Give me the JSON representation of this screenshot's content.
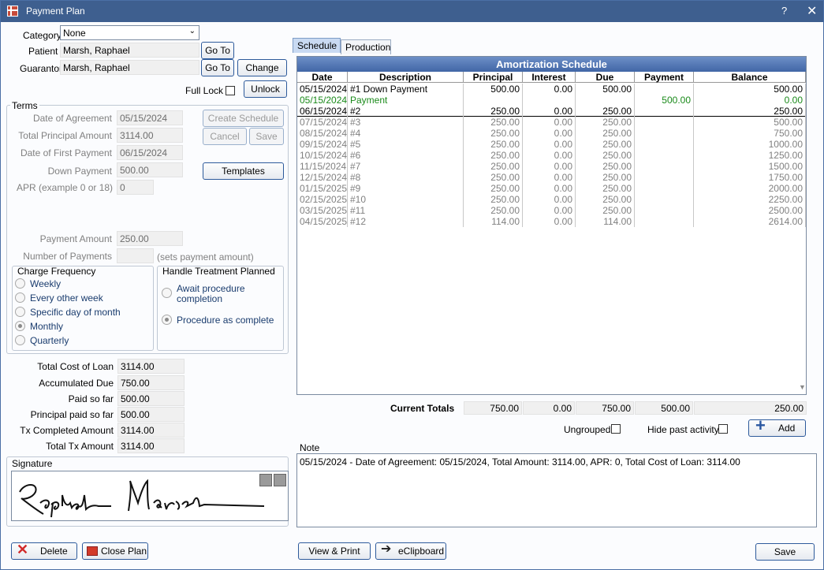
{
  "window": {
    "title": "Payment Plan",
    "help": "?",
    "close": "✕"
  },
  "form": {
    "category_label": "Category",
    "category_value": "None",
    "patient_label": "Patient",
    "patient_value": "Marsh, Raphael",
    "guarantor_label": "Guarantor",
    "guarantor_value": "Marsh, Raphael",
    "goto_label": "Go To",
    "change_label": "Change",
    "full_lock_label": "Full Lock",
    "unlock_label": "Unlock"
  },
  "terms": {
    "title": "Terms",
    "date_of_agreement_label": "Date of Agreement",
    "date_of_agreement": "05/15/2024",
    "total_principal_label": "Total Principal Amount",
    "total_principal": "3114.00",
    "first_payment_label": "Date of First Payment",
    "first_payment": "06/15/2024",
    "down_payment_label": "Down Payment",
    "down_payment": "500.00",
    "apr_label": "APR (example 0 or 18)",
    "apr": "0",
    "payment_amount_label": "Payment Amount",
    "payment_amount": "250.00",
    "num_payments_label": "Number of Payments",
    "num_payments": "",
    "sets_payment_label": "(sets payment amount)",
    "create_schedule": "Create Schedule",
    "cancel": "Cancel",
    "save": "Save",
    "templates": "Templates"
  },
  "charge_frequency": {
    "title": "Charge Frequency",
    "options": [
      "Weekly",
      "Every other week",
      "Specific day of month",
      "Monthly",
      "Quarterly"
    ],
    "selected": "Monthly"
  },
  "treatment": {
    "title": "Handle Treatment Planned",
    "opt1_line1": "Await procedure",
    "opt1_line2": "completion",
    "opt2": "Procedure as complete"
  },
  "summary": {
    "total_cost_label": "Total Cost of Loan",
    "total_cost": "3114.00",
    "accumulated_due_label": "Accumulated Due",
    "accumulated_due": "750.00",
    "paid_so_far_label": "Paid so far",
    "paid_so_far": "500.00",
    "principal_paid_label": "Principal paid so far",
    "principal_paid": "500.00",
    "tx_completed_label": "Tx Completed Amount",
    "tx_completed": "3114.00",
    "total_tx_label": "Total Tx Amount",
    "total_tx": "3114.00"
  },
  "signature": {
    "title": "Signature",
    "text": "Raphael Marsh"
  },
  "tabs": [
    "Schedule",
    "Production"
  ],
  "schedule": {
    "title": "Amortization Schedule",
    "columns": [
      "Date",
      "Description",
      "Principal",
      "Interest",
      "Due",
      "Payment",
      "Balance"
    ],
    "rows": [
      [
        "05/15/2024",
        "#1 Down Payment",
        "500.00",
        "0.00",
        "500.00",
        "",
        "500.00"
      ],
      [
        "05/15/2024",
        "Payment",
        "",
        "",
        "",
        "500.00",
        "0.00"
      ],
      [
        "06/15/2024",
        "#2",
        "250.00",
        "0.00",
        "250.00",
        "",
        "250.00"
      ],
      [
        "07/15/2024",
        "#3",
        "250.00",
        "0.00",
        "250.00",
        "",
        "500.00"
      ],
      [
        "08/15/2024",
        "#4",
        "250.00",
        "0.00",
        "250.00",
        "",
        "750.00"
      ],
      [
        "09/15/2024",
        "#5",
        "250.00",
        "0.00",
        "250.00",
        "",
        "1000.00"
      ],
      [
        "10/15/2024",
        "#6",
        "250.00",
        "0.00",
        "250.00",
        "",
        "1250.00"
      ],
      [
        "11/15/2024",
        "#7",
        "250.00",
        "0.00",
        "250.00",
        "",
        "1500.00"
      ],
      [
        "12/15/2024",
        "#8",
        "250.00",
        "0.00",
        "250.00",
        "",
        "1750.00"
      ],
      [
        "01/15/2025",
        "#9",
        "250.00",
        "0.00",
        "250.00",
        "",
        "2000.00"
      ],
      [
        "02/15/2025",
        "#10",
        "250.00",
        "0.00",
        "250.00",
        "",
        "2250.00"
      ],
      [
        "03/15/2025",
        "#11",
        "250.00",
        "0.00",
        "250.00",
        "",
        "2500.00"
      ],
      [
        "04/15/2025",
        "#12",
        "114.00",
        "0.00",
        "114.00",
        "",
        "2614.00"
      ]
    ],
    "row_colors": [
      "#000000",
      "#1a8a1a",
      "#000000",
      "#808080",
      "#808080",
      "#808080",
      "#808080",
      "#808080",
      "#808080",
      "#808080",
      "#808080",
      "#808080",
      "#808080"
    ],
    "totals_label": "Current Totals",
    "totals": [
      "750.00",
      "0.00",
      "750.00",
      "500.00",
      "250.00"
    ],
    "ungrouped_label": "Ungrouped",
    "hide_past_label": "Hide past activity",
    "add_label": "Add"
  },
  "note": {
    "label": "Note",
    "text": "05/15/2024 - Date of Agreement: 05/15/2024, Total Amount: 3114.00, APR: 0, Total Cost of Loan: 3114.00"
  },
  "footer": {
    "delete": "Delete",
    "close_plan": "Close Plan",
    "view_print": "View & Print",
    "eclipboard": "eClipboard",
    "save": "Save"
  }
}
